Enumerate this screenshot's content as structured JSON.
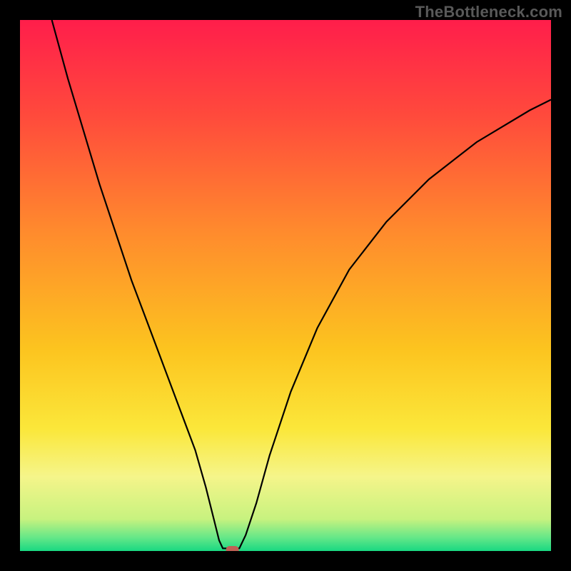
{
  "watermark": "TheBottleneck.com",
  "chart_data": {
    "type": "line",
    "title": "",
    "xlabel": "",
    "ylabel": "",
    "xlim": [
      0,
      100
    ],
    "ylim": [
      0,
      100
    ],
    "grid": false,
    "background_gradient": {
      "description": "vertical gradient red → orange → yellow → green",
      "stops": [
        {
          "offset": 0.0,
          "color": "#ff1e4b"
        },
        {
          "offset": 0.18,
          "color": "#ff4a3c"
        },
        {
          "offset": 0.4,
          "color": "#ff8b2d"
        },
        {
          "offset": 0.62,
          "color": "#fcc41f"
        },
        {
          "offset": 0.77,
          "color": "#fbe73a"
        },
        {
          "offset": 0.86,
          "color": "#f5f58a"
        },
        {
          "offset": 0.94,
          "color": "#c7f27f"
        },
        {
          "offset": 0.975,
          "color": "#64e788"
        },
        {
          "offset": 1.0,
          "color": "#19d882"
        }
      ]
    },
    "series": [
      {
        "name": "curve",
        "color": "#000000",
        "x": [
          6,
          9,
          12,
          15,
          18,
          21,
          24,
          27,
          30,
          33,
          35,
          36.5,
          37.5,
          38.2,
          40.5,
          41.3,
          42.5,
          44.5,
          47,
          51,
          56,
          62,
          69,
          77,
          86,
          96,
          100
        ],
        "y": [
          100,
          89,
          79,
          69,
          60,
          51,
          43,
          35,
          27,
          19,
          12,
          6,
          2,
          0.5,
          0.5,
          0.5,
          3,
          9,
          18,
          30,
          42,
          53,
          62,
          70,
          77,
          83,
          85
        ]
      }
    ],
    "marker": {
      "x": 40,
      "y": 0,
      "color": "#c06055",
      "shape": "rounded-rect"
    }
  }
}
